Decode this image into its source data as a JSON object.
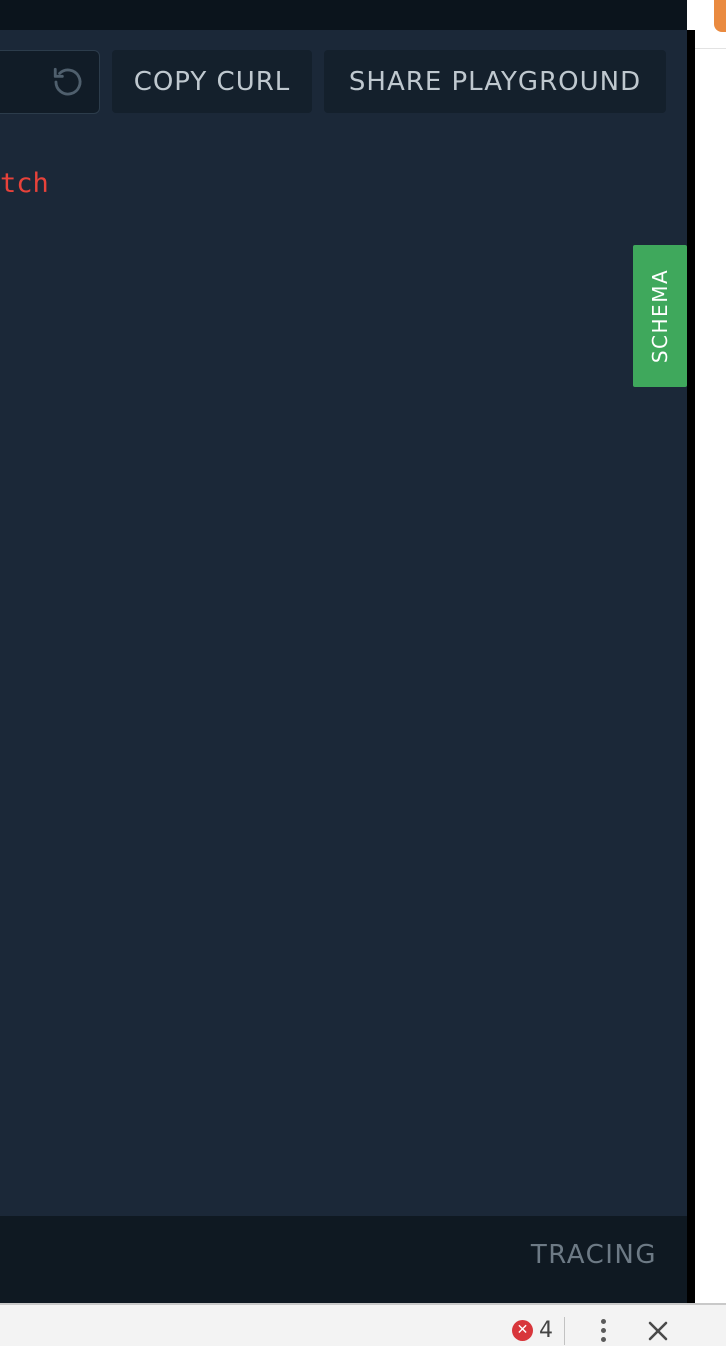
{
  "toolbar": {
    "copy_curl_label": "COPY CURL",
    "share_label": "SHARE PLAYGROUND",
    "reload_icon": "reload-icon"
  },
  "editor": {
    "visible_text": "tch"
  },
  "side_tabs": {
    "schema_label": "SCHEMA"
  },
  "footer": {
    "tracing_label": "TRACING"
  },
  "devtools": {
    "error_count": "4",
    "error_icon": "error-icon",
    "menu_icon": "kebab-menu-icon",
    "close_icon": "close-icon"
  },
  "colors": {
    "editor_bg": "#1b2838",
    "button_bg": "#14202c",
    "button_text": "#bfc8cf",
    "error_text": "#e8423a",
    "schema_tab": "#3fa85c",
    "footer_bg": "#0f1922",
    "tracing_text": "#6d7a85",
    "devtools_error": "#d8363b",
    "browser_accent": "#ea8a3f"
  }
}
